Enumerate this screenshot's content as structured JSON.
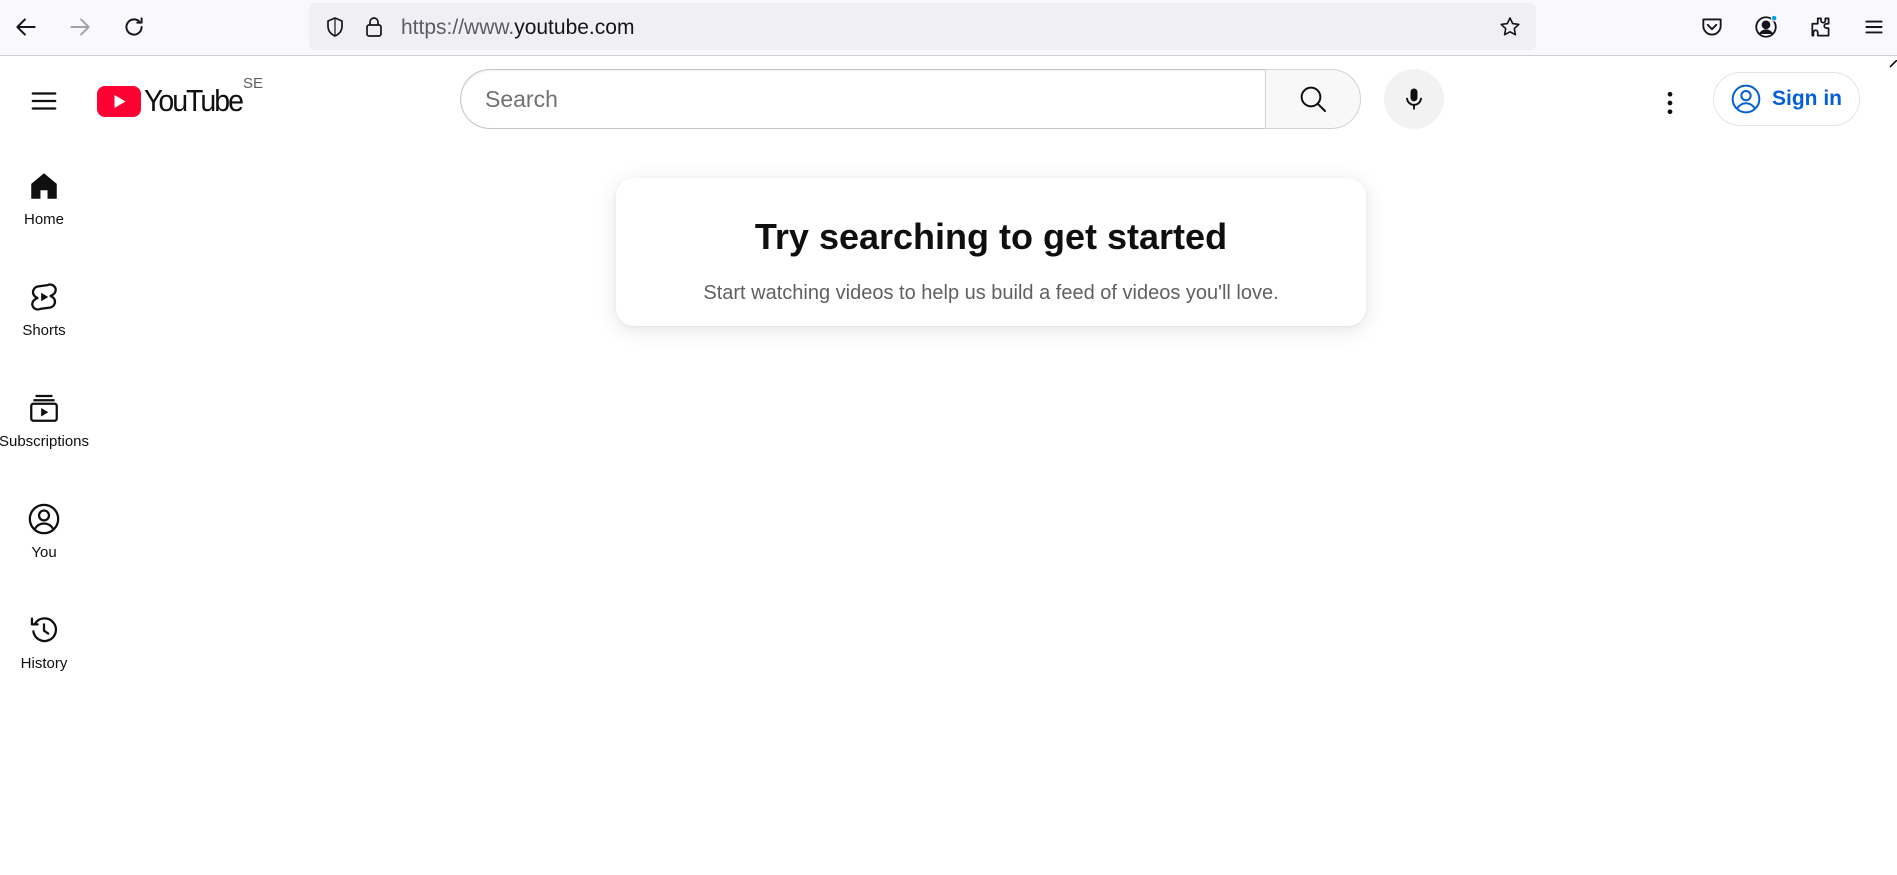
{
  "browser": {
    "url_prefix": "https://www.",
    "url_domain": "youtube.com",
    "icons": {
      "back": "arrow-left-icon",
      "forward": "arrow-right-icon",
      "reload": "reload-icon",
      "tracking": "shield-icon",
      "lock": "lock-icon",
      "bookmark": "star-icon",
      "pocket": "pocket-icon",
      "account": "account-icon",
      "extensions": "puzzle-icon",
      "menu": "hamburger-icon"
    }
  },
  "masthead": {
    "logo_text": "YouTube",
    "country_code": "SE",
    "search_placeholder": "Search",
    "signin_label": "Sign in",
    "brand_red": "#ff0033",
    "link_blue": "#065fd4"
  },
  "guide": {
    "items": [
      {
        "label": "Home",
        "icon": "home-icon"
      },
      {
        "label": "Shorts",
        "icon": "shorts-icon"
      },
      {
        "label": "Subscriptions",
        "icon": "subscriptions-icon"
      },
      {
        "label": "You",
        "icon": "you-icon"
      },
      {
        "label": "History",
        "icon": "history-icon"
      }
    ]
  },
  "feed_prompt": {
    "title": "Try searching to get started",
    "subtitle": "Start watching videos to help us build a feed of videos you'll love."
  }
}
